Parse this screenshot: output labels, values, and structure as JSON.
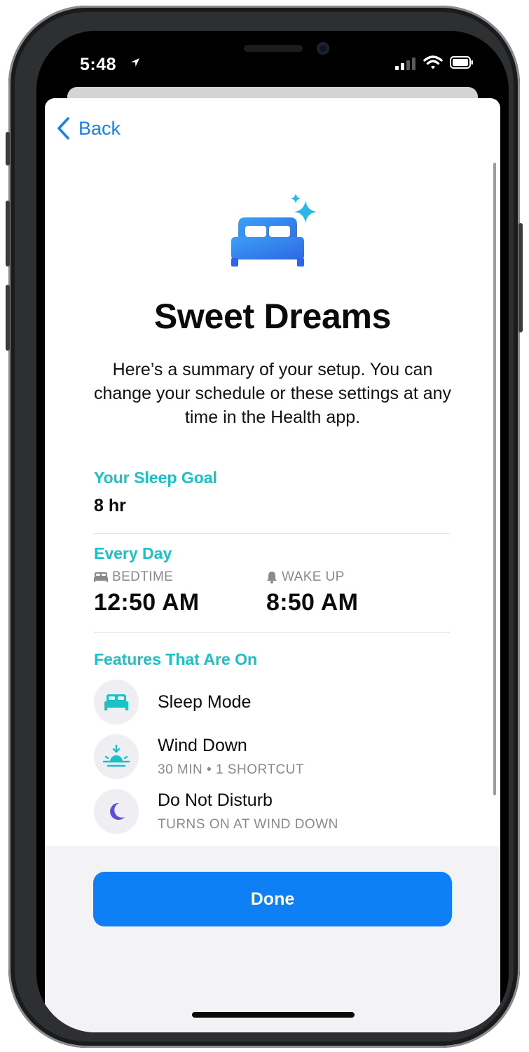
{
  "status_bar": {
    "time": "5:48"
  },
  "nav": {
    "back_label": "Back"
  },
  "header": {
    "title": "Sweet Dreams",
    "summary": "Here’s a summary of your setup. You can change your schedule or these settings at any time in the Health app."
  },
  "sleep_goal": {
    "label": "Your Sleep Goal",
    "value": "8 hr"
  },
  "schedule": {
    "label": "Every Day",
    "bedtime_label": "BEDTIME",
    "bedtime_value": "12:50 AM",
    "wakeup_label": "WAKE UP",
    "wakeup_value": "8:50 AM"
  },
  "features": {
    "label": "Features That Are On",
    "items": [
      {
        "name": "Sleep Mode",
        "icon": "bed-icon",
        "subtitle": ""
      },
      {
        "name": "Wind Down",
        "icon": "sunset-icon",
        "subtitle": "30 MIN • 1 SHORTCUT"
      },
      {
        "name": "Do Not Disturb",
        "icon": "moon-icon",
        "subtitle": "TURNS ON AT WIND DOWN"
      }
    ]
  },
  "footer": {
    "done_label": "Done"
  },
  "colors": {
    "accent": "#1d7ef0",
    "section_teal": "#19c2c6",
    "done_button": "#0f7ff5",
    "moon_purple": "#5b4fd6"
  }
}
